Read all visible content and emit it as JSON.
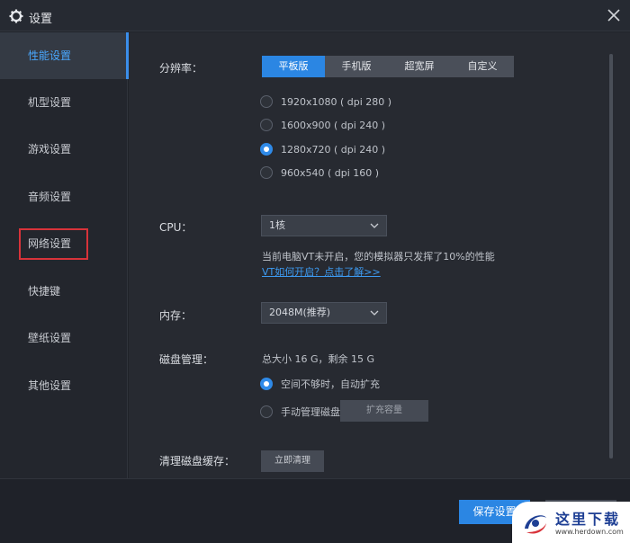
{
  "window": {
    "title": "设置"
  },
  "sidebar": {
    "items": [
      {
        "label": "性能设置"
      },
      {
        "label": "机型设置"
      },
      {
        "label": "游戏设置"
      },
      {
        "label": "音频设置"
      },
      {
        "label": "网络设置"
      },
      {
        "label": "快捷键"
      },
      {
        "label": "壁纸设置"
      },
      {
        "label": "其他设置"
      }
    ],
    "active_index": 0
  },
  "performance": {
    "resolution": {
      "label": "分辨率：",
      "tabs": [
        "平板版",
        "手机版",
        "超宽屏",
        "自定义"
      ],
      "active_tab": 0,
      "options": [
        {
          "text": "1920x1080 ( dpi 280 )",
          "selected": false
        },
        {
          "text": "1600x900 ( dpi 240 )",
          "selected": false
        },
        {
          "text": "1280x720 ( dpi 240 )",
          "selected": true
        },
        {
          "text": "960x540 ( dpi 160 )",
          "selected": false
        }
      ]
    },
    "cpu": {
      "label": "CPU：",
      "value": "1核",
      "note": "当前电脑VT未开启，您的模拟器只发挥了10%的性能",
      "link": "VT如何开启？点击了解>>"
    },
    "memory": {
      "label": "内存：",
      "value": "2048M(推荐)"
    },
    "disk": {
      "label": "磁盘管理：",
      "summary": "总大小 16 G，剩余 15 G",
      "options": [
        {
          "text": "空间不够时，自动扩充",
          "selected": true
        },
        {
          "text": "手动管理磁盘大小",
          "selected": false
        }
      ],
      "expand_button": "扩充容量"
    },
    "cache": {
      "label": "清理磁盘缓存：",
      "button": "立即清理"
    }
  },
  "footer": {
    "save_label": "保存设置",
    "cancel_label": ""
  },
  "watermark": {
    "name": "这里下载",
    "url": "www.herdown.com"
  },
  "colors": {
    "accent": "#2b86e3",
    "link": "#3d9bf2",
    "highlight_box": "#d8333a"
  }
}
